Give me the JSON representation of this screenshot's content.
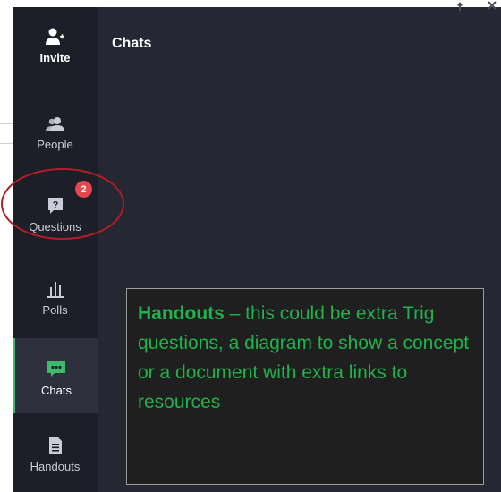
{
  "sidebar": {
    "items": [
      {
        "id": "invite",
        "label": "Invite",
        "icon": "add-user-icon"
      },
      {
        "id": "people",
        "label": "People",
        "icon": "people-icon"
      },
      {
        "id": "questions",
        "label": "Questions",
        "icon": "question-bubble-icon",
        "badge": "2"
      },
      {
        "id": "polls",
        "label": "Polls",
        "icon": "bar-chart-icon"
      },
      {
        "id": "chats",
        "label": "Chats",
        "icon": "chat-bubble-icon",
        "active": true
      },
      {
        "id": "handouts",
        "label": "Handouts",
        "icon": "document-icon"
      }
    ]
  },
  "main": {
    "title": "Chats"
  },
  "annotation": {
    "bold": "Handouts",
    "text": " – this could be extra Trig questions, a diagram to show a concept or a document with extra links to resources"
  },
  "colors": {
    "panel": "#252733",
    "sidebar": "#1c1e28",
    "active_accent": "#3fb96b",
    "badge": "#e6474d",
    "annotation_text": "#20b24b",
    "highlight_ring": "#b01e24"
  }
}
